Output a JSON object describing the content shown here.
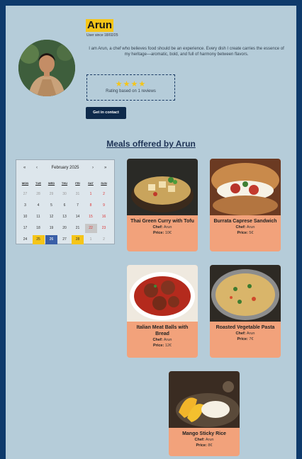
{
  "profile": {
    "name": "Arun",
    "since": "User since 18/02/25",
    "bio": "I am Arun, a chef who believes food should be an experience. Every dish I create carries the essence of my heritage—aromatic, bold, and full of harmony between flavors.",
    "rating_text": "Rating based on 1 reviews",
    "stars": "★★★★",
    "contact_label": "Get in contact"
  },
  "section": {
    "meals_title": "Meals offered by Arun"
  },
  "calendar": {
    "prev_year": "«",
    "prev_month": "‹",
    "month_label": "February 2025",
    "next_month": "›",
    "next_year": "»",
    "weekdays": [
      "MON",
      "TUE",
      "WED",
      "THU",
      "FRI",
      "SAT",
      "SUN"
    ],
    "weeks": [
      [
        "27",
        "28",
        "29",
        "30",
        "31",
        "1",
        "2"
      ],
      [
        "3",
        "4",
        "5",
        "6",
        "7",
        "8",
        "9"
      ],
      [
        "10",
        "11",
        "12",
        "13",
        "14",
        "15",
        "16"
      ],
      [
        "17",
        "18",
        "19",
        "20",
        "21",
        "22",
        "23"
      ],
      [
        "24",
        "25",
        "26",
        "27",
        "28",
        "1",
        "2"
      ]
    ]
  },
  "meals": [
    {
      "title": "Thai Green Curry with Tofu",
      "chef_label": "Chef:",
      "chef": "Arun",
      "price_label": "Price:",
      "price": "10€"
    },
    {
      "title": "Burrata Caprese Sandwich",
      "chef_label": "Chef:",
      "chef": "Arun",
      "price_label": "Price:",
      "price": "5€"
    },
    {
      "title": "Italian Meat Balls with Bread",
      "chef_label": "Chef:",
      "chef": "Arun",
      "price_label": "Price:",
      "price": "12€"
    },
    {
      "title": "Roasted Vegetable Pasta",
      "chef_label": "Chef:",
      "chef": "Arun",
      "price_label": "Price:",
      "price": "7€"
    },
    {
      "title": "Mango Sticky Rice",
      "chef_label": "Chef:",
      "chef": "Arun",
      "price_label": "Price:",
      "price": "8€"
    }
  ],
  "colors": {
    "accent": "#f5c518",
    "card": "#f2a27b",
    "background": "#0e3a6b",
    "panel": "#b5ccd9"
  }
}
